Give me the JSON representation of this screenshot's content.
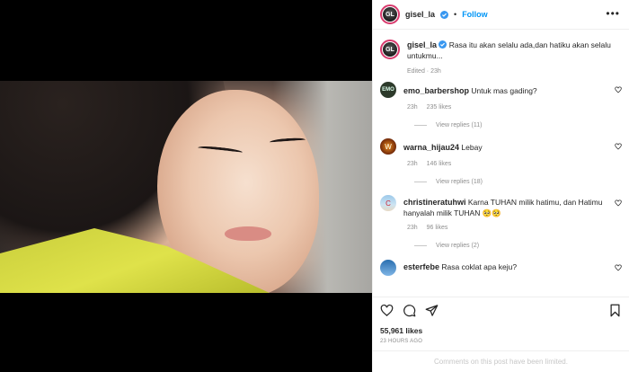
{
  "post": {
    "username": "gisel_la",
    "follow_label": "Follow",
    "separator": "•",
    "more_label": "•••",
    "caption": "Rasa itu akan selalu ada,dan hatiku akan selalu untukmu...",
    "caption_meta": "Edited · 23h",
    "avatar_initials": "GL"
  },
  "comments": [
    {
      "username": "emo_barbershop",
      "text": "Untuk mas gading?",
      "time": "23h",
      "likes": "235 likes",
      "replies": "View replies (11)",
      "avatar": "EMO"
    },
    {
      "username": "warna_hijau24",
      "text": "Lebay",
      "time": "23h",
      "likes": "146 likes",
      "replies": "View replies (18)",
      "avatar": "W"
    },
    {
      "username": "christineratuhwi",
      "text": "Karna TUHAN milik hatimu, dan Hatimu hanyalah milik TUHAN 🥺🥺",
      "time": "23h",
      "likes": "96 likes",
      "replies": "View replies (2)",
      "avatar": "C"
    },
    {
      "username": "esterfebe",
      "text": "Rasa coklat apa keju?",
      "avatar": ""
    }
  ],
  "footer": {
    "likes": "55,961 likes",
    "time_ago": "23 HOURS AGO",
    "comments_limited": "Comments on this post have been limited."
  },
  "icons": {
    "verified": "verified-badge-icon",
    "heart": "heart-icon",
    "comment": "comment-icon",
    "share": "share-icon",
    "bookmark": "bookmark-icon"
  },
  "colors": {
    "accent": "#0095f6",
    "text": "#262626",
    "muted": "#8e8e8e",
    "verified": "#3897f0"
  }
}
